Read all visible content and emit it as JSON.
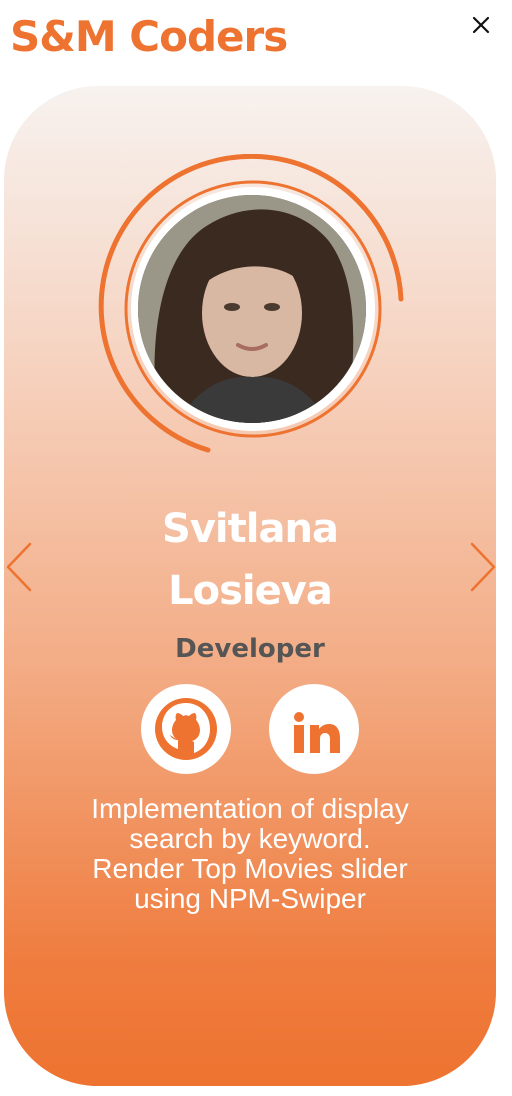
{
  "brand": {
    "title": "S&M Coders"
  },
  "close": {
    "icon": "close-icon"
  },
  "member": {
    "name_line1": "Svitlana",
    "name_line2": "Losieva",
    "role": "Developer",
    "description_lines": [
      "Implementation of display",
      "search by keyword.",
      "Render Top Movies slider",
      "using NPM-Swiper"
    ]
  },
  "social": {
    "github_icon": "github-icon",
    "linkedin_icon": "linkedin-icon"
  },
  "navigation": {
    "prev_icon": "chevron-left-icon",
    "next_icon": "chevron-right-icon"
  },
  "colors": {
    "accent": "#ee7330",
    "card_top": "#f7f2ef",
    "card_bottom": "#ee7330",
    "role_text": "#555555"
  }
}
